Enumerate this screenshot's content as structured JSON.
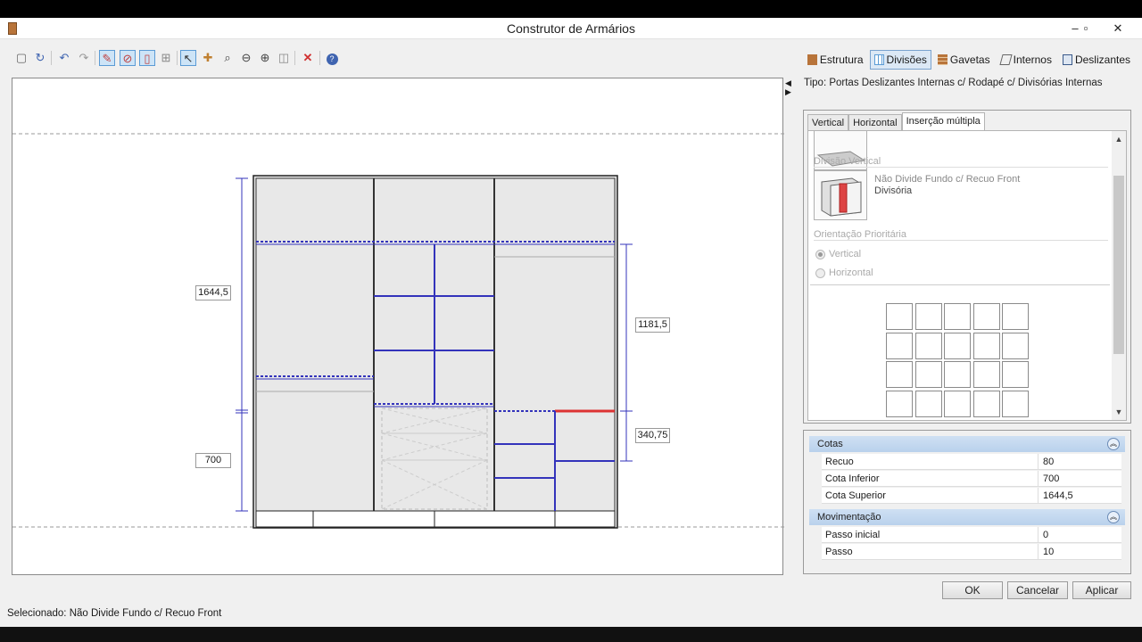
{
  "window": {
    "title": "Construtor de Armários",
    "minimize": "–",
    "maximize": "▫",
    "close": "✕"
  },
  "toolbar": {
    "icons": [
      "new-icon",
      "refresh-icon",
      "undo-icon",
      "redo-icon",
      "edit-division-icon",
      "edit-shelf-icon",
      "edit-door-icon",
      "grid-icon",
      "pointer-icon",
      "add-icon",
      "zoom-fit-icon",
      "zoom-out-icon",
      "zoom-in-icon",
      "frame-icon",
      "delete-icon",
      "help-icon"
    ]
  },
  "modes": [
    {
      "label": "Estrutura",
      "color": "#b8743a"
    },
    {
      "label": "Divisões",
      "color": "#5b9bd5"
    },
    {
      "label": "Gavetas",
      "color": "#b8743a"
    },
    {
      "label": "Internos",
      "color": "#666666"
    },
    {
      "label": "Deslizantes",
      "color": "#3a5a8a"
    }
  ],
  "canvas": {
    "dim_total": "1644,5",
    "dim_lower": "700",
    "dim_right_upper": "1181,5",
    "dim_right_lower": "340,75"
  },
  "tipo": "Tipo: Portas Deslizantes Internas c/ Rodapé c/ Divisórias Internas",
  "tabs": [
    {
      "label": "Vertical"
    },
    {
      "label": "Horizontal"
    },
    {
      "label": "Inserção múltipla"
    }
  ],
  "insercao": {
    "divisao_vertical_group": "Divisão Vertical",
    "item_name": "Não Divide Fundo c/ Recuo Front",
    "item_type": "Divisória",
    "orientacao_group": "Orientação Prioritária",
    "radio_vertical": "Vertical",
    "radio_horizontal": "Horizontal"
  },
  "props": {
    "cotas_title": "Cotas",
    "cotas": [
      {
        "k": "Recuo",
        "v": "80"
      },
      {
        "k": "Cota Inferior",
        "v": "700"
      },
      {
        "k": "Cota Superior",
        "v": "1644,5"
      }
    ],
    "mov_title": "Movimentação",
    "mov": [
      {
        "k": "Passo inicial",
        "v": "0"
      },
      {
        "k": "Passo",
        "v": "10"
      }
    ]
  },
  "buttons": {
    "ok": "OK",
    "cancel": "Cancelar",
    "apply": "Aplicar"
  },
  "status": "Selecionado: Não Divide Fundo c/ Recuo Front"
}
